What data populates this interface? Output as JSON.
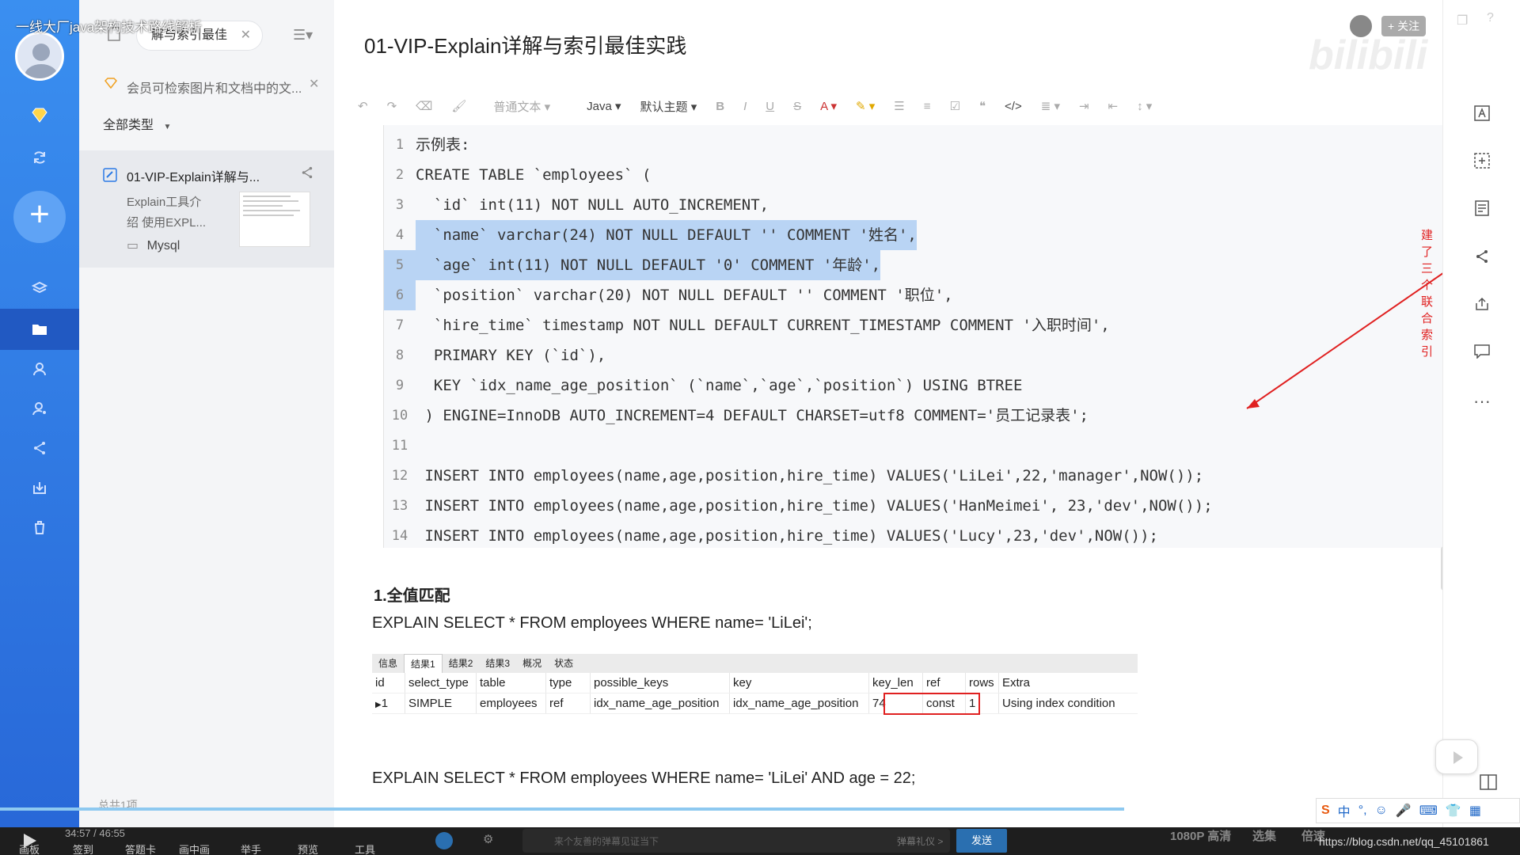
{
  "overlay_title": "一线大厂java架构技术路线解析",
  "sidebar": {
    "tab_label": "解与索引最佳",
    "member_notice": "会员可检索图片和文档中的文...",
    "filter_label": "全部类型",
    "doc": {
      "title": "01-VIP-Explain详解与...",
      "preview_line1": "Explain工具介",
      "preview_line2": "绍 使用EXPL...",
      "folder": "Mysql"
    },
    "footer": "总共1项"
  },
  "document": {
    "title": "01-VIP-Explain详解与索引最佳实践"
  },
  "toolbar": {
    "paragraph_style": "普通文本",
    "language": "Java",
    "theme": "默认主题"
  },
  "code_lines": [
    "示例表:",
    "CREATE TABLE `employees` (",
    "  `id` int(11) NOT NULL AUTO_INCREMENT,",
    "  `name` varchar(24) NOT NULL DEFAULT '' COMMENT '姓名',",
    "  `age` int(11) NOT NULL DEFAULT '0' COMMENT '年龄',",
    "  `position` varchar(20) NOT NULL DEFAULT '' COMMENT '职位',",
    "  `hire_time` timestamp NOT NULL DEFAULT CURRENT_TIMESTAMP COMMENT '入职时间',",
    "  PRIMARY KEY (`id`),",
    "  KEY `idx_name_age_position` (`name`,`age`,`position`) USING BTREE",
    " ) ENGINE=InnoDB AUTO_INCREMENT=4 DEFAULT CHARSET=utf8 COMMENT='员工记录表';",
    "",
    " INSERT INTO employees(name,age,position,hire_time) VALUES('LiLei',22,'manager',NOW());",
    " INSERT INTO employees(name,age,position,hire_time) VALUES('HanMeimei', 23,'dev',NOW());",
    " INSERT INTO employees(name,age,position,hire_time) VALUES('Lucy',23,'dev',NOW());"
  ],
  "annotation": "建了三个联合索引",
  "section1": {
    "heading": "1.全值匹配",
    "query1": "EXPLAIN SELECT * FROM employees WHERE name= 'LiLei';",
    "query2": "EXPLAIN SELECT * FROM employees WHERE name= 'LiLei' AND age = 22;"
  },
  "result_tabs": [
    "信息",
    "结果1",
    "结果2",
    "结果3",
    "概况",
    "状态"
  ],
  "result_headers": [
    "id",
    "select_type",
    "table",
    "type",
    "possible_keys",
    "key",
    "key_len",
    "ref",
    "rows",
    "Extra"
  ],
  "result_row": [
    "1",
    "SIMPLE",
    "employees",
    "ref",
    "idx_name_age_position",
    "idx_name_age_position",
    "74",
    "const",
    "1",
    "Using index condition"
  ],
  "header_right": {
    "follow_label": "+ 关注",
    "brand": "bilibili"
  },
  "player": {
    "time": "34:57 / 46:55",
    "controls": [
      "画板",
      "签到",
      "答题卡",
      "画中画",
      "举手",
      "预览",
      "工具"
    ],
    "danmaku_placeholder": "来个友善的弹幕见证当下",
    "danmaku_etiquette": "弹幕礼仪 >",
    "send_label": "发送",
    "quality": "1080P 高清",
    "episodes": "选集",
    "speed": "倍速",
    "watermark": "https://blog.csdn.net/qq_45101861"
  },
  "colors": {
    "rail_blue": "#2c7be5",
    "highlight": "#b9d4f4",
    "keyword": "#7a2f9a",
    "string": "#c0331e",
    "annotation_red": "#e02020"
  }
}
